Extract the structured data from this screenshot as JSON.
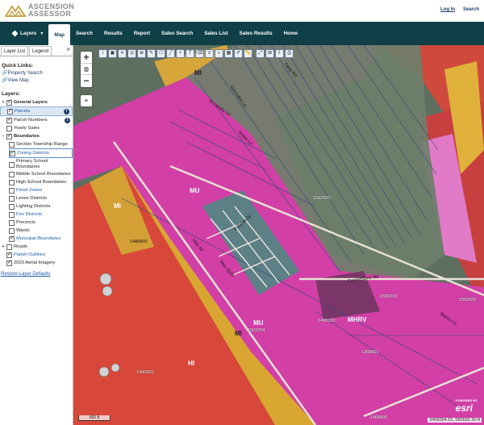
{
  "header": {
    "logo_line1": "ASCENSION",
    "logo_line2": "ASSESSOR",
    "login": "Log In",
    "search": "Search"
  },
  "nav": {
    "layers": "Layers",
    "items": [
      "Map",
      "Search",
      "Results",
      "Report",
      "Sales Search",
      "Sales List",
      "Sales Results",
      "Home"
    ]
  },
  "panel": {
    "tab_layer_list": "Layer List",
    "tab_legend": "Legend",
    "close": "×",
    "quick_links_title": "Quick Links:",
    "quick_links": [
      "Property Search",
      "View Map"
    ],
    "layers_title": "Layers:",
    "general_layers": "General Layers",
    "parcels": "Parcels",
    "parcel_numbers": "Parcel Numbers",
    "yearly_sales": "Yearly Sales",
    "boundaries": "Boundaries",
    "section_township_range": "Section Township Range",
    "zoning_districts": "Zoning Districts",
    "primary_school": "Primary School Boundaries",
    "middle_school": "Middle School Boundaries",
    "high_school": "High School Boundaries",
    "flood_zones": "Flood Zones",
    "levee_districts": "Levee Districts",
    "lighting_districts": "Lighting Districts",
    "fire_districts": "Fire Districts",
    "precincts": "Precincts",
    "wards": "Wards",
    "municipal_boundaries": "Municipal Boundaries",
    "roads": "Roads",
    "parish_outlines": "Parish Outlines",
    "aerial_2023": "2023 Aerial Imagery",
    "restore": "Restore Layer Defaults"
  },
  "map": {
    "zoom_in": "+",
    "zoom_out": "−",
    "zone_labels": {
      "mi_top": "MI",
      "mi_left": "MI",
      "mu_center": "MU",
      "mu_bottom": "MU",
      "mi_bottom": "MI",
      "hi": "HI",
      "mhrv": "MHRV"
    },
    "parcel_labels": {
      "p1": "1582600",
      "p2": "1489600",
      "p3": "1508200",
      "p4": "1562600",
      "p5": "1498100",
      "p6": "1503704",
      "p7": "1368001",
      "p8": "1400600",
      "p9": "1408000"
    },
    "streets": {
      "s1": "Gonzales Ln",
      "s2": "St Landry Ln",
      "s3": "Robin Ln",
      "s4": "Hwy 44",
      "s5": "E Dawn Dr",
      "s6": "Hwy 3120",
      "s7": "Cornerstone Rd",
      "s8": "Bayou Ln",
      "s9": "Ferry Rd"
    },
    "scale": "660 ft",
    "coords": "3405054.53, 582692.30 ft",
    "esri_powered": "POWERED BY",
    "esri": "esri"
  }
}
